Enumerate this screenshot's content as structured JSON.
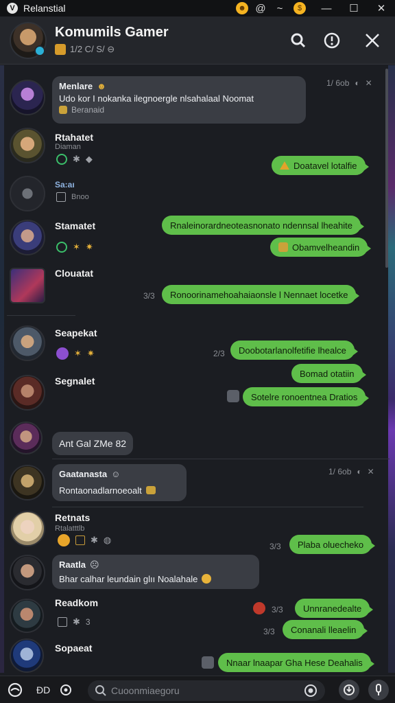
{
  "window": {
    "app_name": "Relanstial",
    "logo_letter": "V",
    "tray_glyphs": [
      "@",
      "~"
    ],
    "win_controls": [
      "—",
      "☐",
      "✕"
    ]
  },
  "header": {
    "title": "Komumils Gamer",
    "subtitle": "1/2 C/ S/ ⊖"
  },
  "messages": [
    {
      "name": "Menlare",
      "badge": "☻",
      "bubble_text": "Udo kor I nokanka ilegnoergle nlsahalaal Noomat",
      "quote": "Beranaid",
      "time": "1/ 6ob"
    },
    {
      "name": "Rtahatet",
      "sub": "Diaman",
      "out": "Doatavel lotalfie"
    },
    {
      "name": "Sa:aı",
      "sub": "Bnoo"
    },
    {
      "name": "Stamatet",
      "out1": "Rnaleinorardneoteasnonato ndennsal lheahite",
      "out2": "Obamvelheandin"
    },
    {
      "name": "Clouatat",
      "time": "3/3",
      "out": "Ronoorinamehoahaiaonsle l Nennaet locetke"
    },
    {
      "name": "Seapekat",
      "time": "2/3",
      "out1": "Doobotarlanolfetifie lhealce",
      "out2": "Bomad otatiin",
      "out3": "Sotelre ronoentnea Dratios"
    },
    {
      "name": "Segnalet",
      "bubble_text": "Ant Gal ZMe 82"
    },
    {
      "name": "Gaatanasta",
      "badge": "☺",
      "bubble_text": "Rontaonadlarnoeoalt",
      "time": "1/ 6ob"
    },
    {
      "name": "Retnats",
      "sub": "Rtalatttlb",
      "time": "3/3",
      "out": "Plaba oluecheko"
    },
    {
      "name": "Raatla",
      "badge": "☹",
      "bubble_text": "Bhar calhar leundain glıı Noalahale"
    },
    {
      "name": "Readkom",
      "time1": "3/3",
      "time2": "3/3",
      "out1": "Unnranedealte",
      "out2": "Conanali lleaelin"
    },
    {
      "name": "Sopaeat",
      "out": "Nnaar lnaapar Gha Hese Deahalis"
    }
  ],
  "input": {
    "placeholder": "Cuoonmiaegoru"
  },
  "colors": {
    "accent_green": "#5fbe4a",
    "bubble_in": "#3a3d44",
    "background": "#1b1d22"
  },
  "icons": [
    "search-icon",
    "info-icon",
    "close-icon",
    "emoji-icon",
    "attach-icon",
    "gif-icon",
    "mic-icon",
    "send-icon"
  ]
}
